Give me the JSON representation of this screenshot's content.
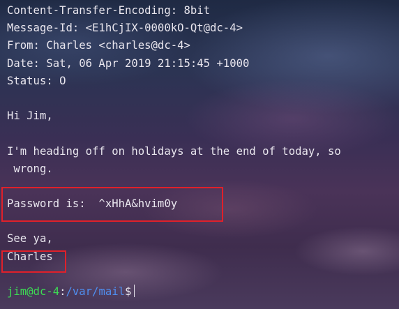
{
  "mail": {
    "header_lines": [
      "Content-Transfer-Encoding: 8bit",
      "Message-Id: <E1hCjIX-0000kO-Qt@dc-4>",
      "From: Charles <charles@dc-4>",
      "Date: Sat, 06 Apr 2019 21:15:45 +1000",
      "Status: O"
    ],
    "greeting": "Hi Jim,",
    "body_line_1": "I'm heading off on holidays at the end of today, so",
    "body_line_2": " wrong.",
    "password_line": "Password is:  ^xHhA&hvim0y",
    "signoff": "See ya,",
    "signature": "Charles"
  },
  "prompt": {
    "user_host": "jim@dc-4",
    "separator": ":",
    "path": "/var/mail",
    "symbol": "$"
  },
  "colors": {
    "text": "#e9e6ee",
    "prompt_user": "#3ddc54",
    "prompt_path": "#4f8ff0",
    "highlight_box": "#e0202a"
  }
}
